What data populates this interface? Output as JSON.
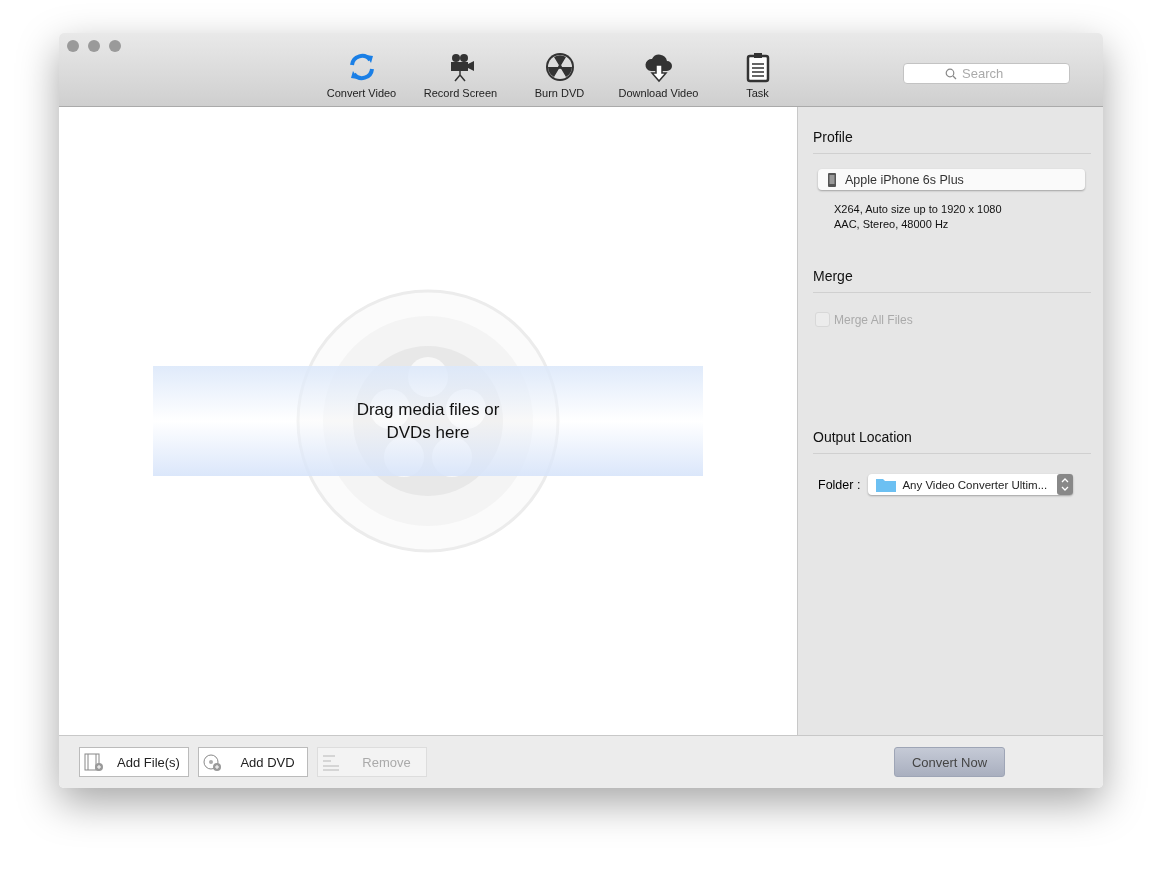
{
  "toolbar": {
    "items": [
      {
        "kind": "convert",
        "label": "Convert Video",
        "selected": true
      },
      {
        "kind": "record",
        "label": "Record Screen",
        "selected": false
      },
      {
        "kind": "burn",
        "label": "Burn DVD",
        "selected": false
      },
      {
        "kind": "download",
        "label": "Download Video",
        "selected": false
      },
      {
        "kind": "task",
        "label": "Task",
        "selected": false
      }
    ],
    "search": {
      "placeholder": "Search"
    }
  },
  "drop_zone": {
    "text": "Drag media files or DVDs here"
  },
  "side_panel": {
    "profile": {
      "heading": "Profile",
      "value": "Apple iPhone 6s Plus",
      "details": [
        "X264, Auto size up to 1920 x 1080",
        "AAC, Stereo, 48000 Hz"
      ]
    },
    "merge": {
      "heading": "Merge",
      "checkbox": {
        "label": "Merge All Files",
        "checked": false,
        "disabled": true
      }
    },
    "output": {
      "heading": "Output Location",
      "label": "Folder :",
      "value": "Any Video Converter Ultim..."
    }
  },
  "bottom_bar": {
    "buttons": [
      {
        "kind": "file",
        "label": "Add File(s)",
        "disabled": false
      },
      {
        "kind": "dvd",
        "label": "Add DVD",
        "disabled": false
      },
      {
        "kind": "remove",
        "label": "Remove",
        "disabled": true
      }
    ],
    "convert": {
      "label": "Convert Now",
      "disabled": false
    }
  }
}
